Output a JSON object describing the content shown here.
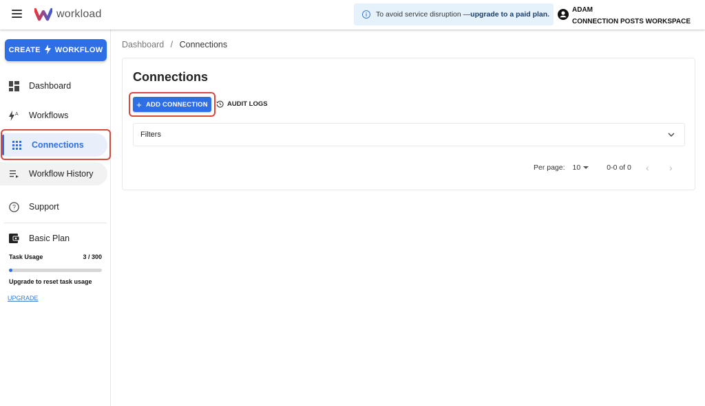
{
  "app": {
    "name": "workload"
  },
  "notice": {
    "text": "To avoid service disruption — ",
    "link": "upgrade to a paid plan."
  },
  "account": {
    "user": "ADAM",
    "workspace": "CONNECTION POSTS WORKSPACE"
  },
  "sidebar": {
    "create": {
      "left": "CREATE",
      "right": "WORKFLOW"
    },
    "items": [
      {
        "label": "Dashboard",
        "icon": "dashboard-icon"
      },
      {
        "label": "Workflows",
        "icon": "workflows-icon"
      },
      {
        "label": "Connections",
        "icon": "grid-icon",
        "active": true
      },
      {
        "label": "Workflow History",
        "icon": "history-list-icon"
      },
      {
        "label": "Support",
        "icon": "help-icon"
      },
      {
        "label": "Basic Plan",
        "icon": "wallet-icon"
      }
    ],
    "task_usage": {
      "label": "Task Usage",
      "count": "3 / 300",
      "used": 3,
      "total": 300
    },
    "upgrade_note": "Upgrade to reset task usage",
    "upgrade_link": "UPGRADE"
  },
  "breadcrumb": {
    "root": "Dashboard",
    "sep": "/",
    "current": "Connections"
  },
  "main": {
    "title": "Connections",
    "add_button": "ADD CONNECTION",
    "audit_button": "AUDIT LOGS",
    "filters_label": "Filters",
    "pager": {
      "per_page_label": "Per page:",
      "per_page_value": "10",
      "range": "0-0 of 0"
    }
  },
  "colors": {
    "accent": "#2f6fe6",
    "highlight": "#d9473c",
    "notice_bg": "#e6f2fb"
  }
}
